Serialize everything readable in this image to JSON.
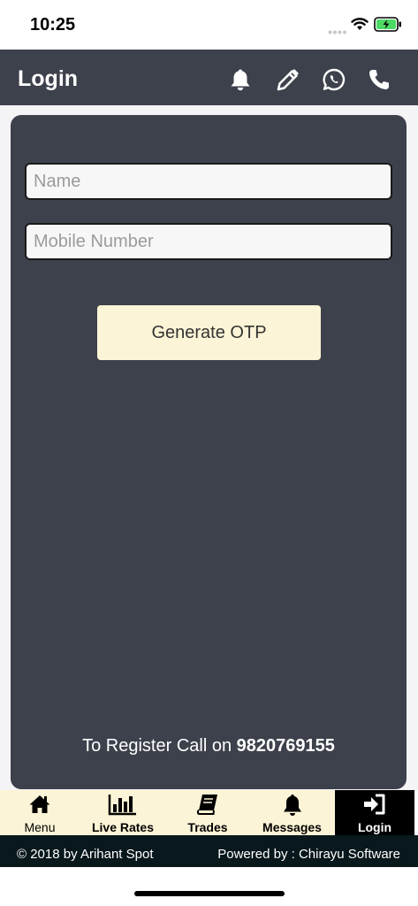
{
  "status_bar": {
    "time": "10:25"
  },
  "header": {
    "title": "Login",
    "icons": [
      "bell-icon",
      "pencil-icon",
      "whatsapp-icon",
      "phone-icon"
    ]
  },
  "form": {
    "name_placeholder": "Name",
    "name_value": "",
    "mobile_placeholder": "Mobile Number",
    "mobile_value": "",
    "otp_button_label": "Generate OTP",
    "register_text": "To Register Call on",
    "register_phone": "9820769155"
  },
  "tabs": [
    {
      "label": "Menu",
      "icon": "home-icon",
      "bold": false,
      "active": false
    },
    {
      "label": "Live Rates",
      "icon": "bar-chart-icon",
      "bold": true,
      "active": false
    },
    {
      "label": "Trades",
      "icon": "book-icon",
      "bold": true,
      "active": false
    },
    {
      "label": "Messages",
      "icon": "bell-icon",
      "bold": true,
      "active": false
    },
    {
      "label": "Login",
      "icon": "sign-in-icon",
      "bold": true,
      "active": true
    }
  ],
  "footer": {
    "copyright": "© 2018 by Arihant Spot",
    "powered_by": "Powered by : Chirayu Software"
  },
  "colors": {
    "header_bg": "#3d414c",
    "card_bg": "#3d414c",
    "accent_cream": "#fcf4d6",
    "footer_bg": "#08181c"
  }
}
